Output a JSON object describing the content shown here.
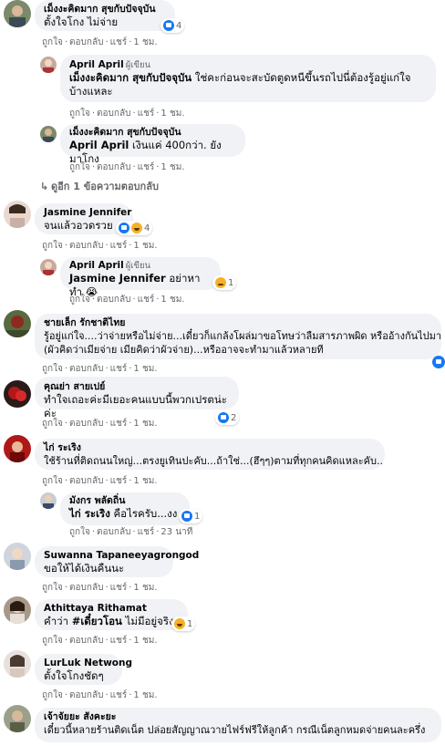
{
  "colors": {
    "bubble": "#f0f2f5",
    "meta": "#65676b",
    "accent": "#1877f2"
  },
  "actions": {
    "like": "ถูกใจ",
    "reply": "ตอบกลับ",
    "share": "แชร์",
    "dot": "·"
  },
  "comments": [
    {
      "name": "เม็งงะคิดมาก สุขกับปัจจุบัน",
      "text": "ตั้งใจโกง ไม่จ่าย",
      "reaction_icons": [
        "like-icon"
      ],
      "reaction_count": "4",
      "time": "1 ชม."
    },
    {
      "name": "April April",
      "author_badge": "ผู้เขียน",
      "mention": "เม็งงะคิดมาก สุขกับปัจจุบัน",
      "text": "ใช่คะก่อนจะสะบัดตูดหนีขึ้นรถไปนี่ต้องรู้อยู่แก่ใจบ้างแหละ",
      "time": "1 ชม."
    },
    {
      "name": "เม็งงะคิดมาก สุขกับปัจจุบัน",
      "mention": "April April",
      "text": "เงินแค่ 400กว่า. ยัง มาโกง",
      "time": "1 ชม."
    },
    {
      "more_replies": "ดูอีก 1 ข้อความตอบกลับ"
    },
    {
      "name": "Jasmine Jennifer",
      "text": "จนแล้วอวดรวย",
      "reaction_icons": [
        "like-icon",
        "haha-icon"
      ],
      "reaction_count": "4",
      "time": "1 ชม."
    },
    {
      "name": "April April",
      "author_badge": "ผู้เขียน",
      "mention": "Jasmine Jennifer",
      "text": "อย่าหาทำ",
      "emoji": "😭",
      "reaction_icons": [
        "sad-icon"
      ],
      "reaction_count": "1",
      "time": "1 ชม."
    },
    {
      "name": "ชายเล็ก รักชาติไทย",
      "text_line1": "รู้อยู่แก่ใจ....ว่าจ่ายหรือไม่จ่าย...เดี๋ยวก็แกล้งโผล่มาขอโทษว่าลืมสารภาพผิด หรืออ้างกันไปมา",
      "text_line2": "(ผัวคิดว่าเมียจ่าย เมียคิดว่าผัวจ่าย)...หรืออาจจะทำมาแล้วหลายที",
      "time": "1 ชม."
    },
    {
      "name": "คุณย่า สายเปย์",
      "text": "ทำใจเถอะค่ะมีเยอะคนแบบนี้พวกเปรตน่ะค่ะ",
      "reaction_icons": [
        "like-icon"
      ],
      "reaction_count": "2",
      "time": "1 ชม."
    },
    {
      "name": "ไก่ ระเริง",
      "text": "ใช้ร้านที่ติดถนนใหญ่...ตรงยูเทินปะคับ...ถ้าใช่...(ฮึๆๆ)ตามที่ทุกคนคิดแหละคับ..",
      "time": "1 ชม."
    },
    {
      "name": "มังกร พลัดถิ่น",
      "mention": "ไก่ ระเริง",
      "text": "คือไรครับ...งง",
      "reaction_icons": [
        "like-icon"
      ],
      "reaction_count": "1",
      "time": "23 นาที"
    },
    {
      "name": "Suwanna Tapaneeyagrongod",
      "text": "ขอให้ได้เงินคืนนะ",
      "time": "1 ชม."
    },
    {
      "name": "Athittaya Rithamat",
      "text_prefix": "คำว่า ",
      "hashtag": "#เดี๋ยวโอน",
      "text": " ไม่มีอยู่จริง",
      "reaction_icons": [
        "haha-icon"
      ],
      "reaction_count": "1",
      "time": "1 ชม."
    },
    {
      "name": "LurLuk Netwong",
      "text": "ตั้งใจโกงชัดๆ",
      "time": "1 ชม."
    },
    {
      "name": "เจ้าจัยยะ สังคะยะ",
      "text": "เดี๋ยวนี้หลายร้านติดเน็ต ปล่อยสัญญาณวายไฟร์ฟรีให้ลูกค้า กรณีเน็ตลูกหมดจ่ายคนละครึ่ง"
    }
  ]
}
